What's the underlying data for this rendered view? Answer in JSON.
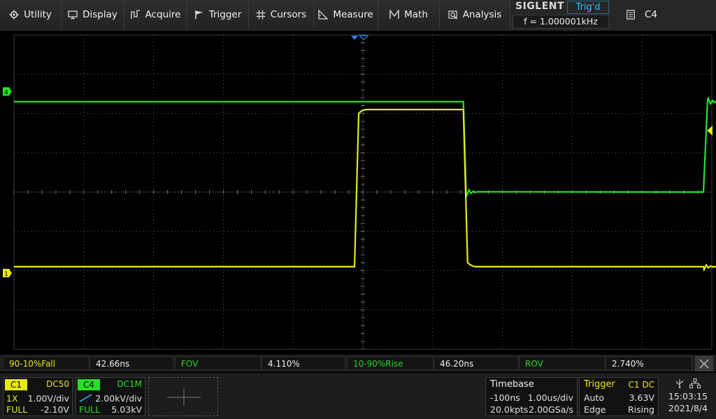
{
  "menu": {
    "items": [
      {
        "label": "Utility",
        "icon": "gear-icon"
      },
      {
        "label": "Display",
        "icon": "monitor-icon"
      },
      {
        "label": "Acquire",
        "icon": "acquire-icon"
      },
      {
        "label": "Trigger",
        "icon": "flag-icon"
      },
      {
        "label": "Cursors",
        "icon": "crosshair-icon"
      },
      {
        "label": "Measure",
        "icon": "measure-icon"
      },
      {
        "label": "Math",
        "icon": "math-icon"
      },
      {
        "label": "Analysis",
        "icon": "analysis-icon"
      }
    ],
    "brand": "SIGLENT",
    "trigger_state": "Trig'd",
    "frequency": "f = 1.000001kHz",
    "selected_channel": "C4"
  },
  "colors": {
    "ch1": "#e8e820",
    "ch4": "#28e028",
    "trig_state": "#2ec6ff",
    "trigger_marker": "#2a80ff",
    "grid": "#5a5a5a",
    "background": "#000000"
  },
  "waveforms": {
    "markers": {
      "ch1": "1",
      "ch4": "4"
    },
    "trace_ch4": {
      "channel": "C4",
      "shape": "pulse",
      "high_level_div": 2.3,
      "low_level_div": 0.0,
      "fall_time_div": 1.46,
      "rise_time_div": 4.9
    },
    "trace_ch1": {
      "channel": "C1",
      "shape": "pulse",
      "high_level_div": 2.1,
      "low_level_div": -1.9,
      "rise_time_div": -0.1,
      "fall_time_div": 1.46
    }
  },
  "measurements": [
    {
      "label": "90-10%Fall",
      "value": "42.66ns",
      "color": "ch1"
    },
    {
      "label": "FOV",
      "value": "4.110%",
      "color": "ch4"
    },
    {
      "label": "10-90%Rise",
      "value": "46.20ns",
      "color": "ch4"
    },
    {
      "label": "ROV",
      "value": "2.740%",
      "color": "ch4"
    }
  ],
  "channels": {
    "c1": {
      "tag": "C1",
      "coupling": "DC50",
      "probe": "1X",
      "scale": "1.00V/div",
      "bandwidth": "FULL",
      "offset": "-2.10V"
    },
    "c4": {
      "tag": "C4",
      "coupling": "DC1M",
      "scale": "2.00kV/div",
      "bandwidth": "FULL",
      "offset": "5.03kV"
    }
  },
  "timebase": {
    "title": "Timebase",
    "delay": "-100ns",
    "scale": "1.00us/div",
    "points": "20.0kpts",
    "rate": "2.00GSa/s"
  },
  "trigger": {
    "title": "Trigger",
    "source": "C1 DC",
    "mode": "Auto",
    "level": "3.63V",
    "type": "Edge",
    "slope": "Rising"
  },
  "clock": {
    "time": "15:03:15",
    "date": "2021/8/4"
  }
}
